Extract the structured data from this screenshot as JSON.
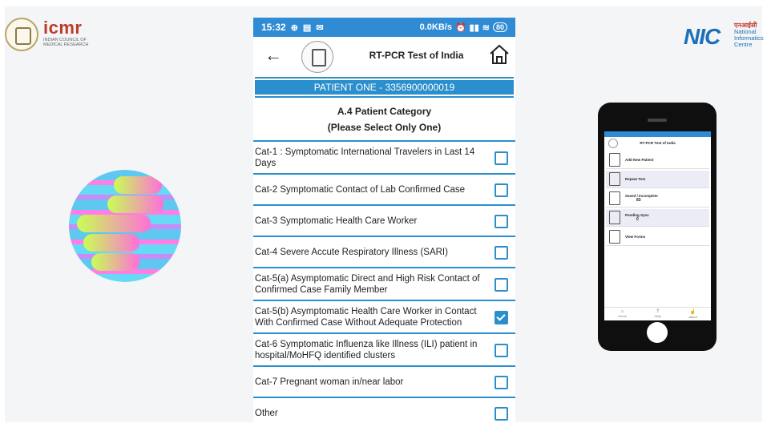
{
  "logos": {
    "icmr_word": "icmr",
    "icmr_sub": "INDIAN COUNCIL OF MEDICAL RESEARCH",
    "nic_word": "NIC",
    "nic_hindi": "एनआईसी",
    "nic_name_1": "National",
    "nic_name_2": "Informatics",
    "nic_name_3": "Centre"
  },
  "status_bar": {
    "time": "15:32",
    "speed": "0.0KB/s",
    "battery": "80",
    "icons": [
      "whatsapp-icon",
      "message-icon",
      "mail-icon"
    ]
  },
  "app": {
    "title": "RT-PCR Test of India",
    "back_icon": "arrow-left-icon",
    "home_icon": "home-icon"
  },
  "patient_banner": "PATIENT ONE - 3356900000019",
  "section": {
    "title": "A.4 Patient Category",
    "subtitle": "(Please Select Only One)"
  },
  "categories": [
    {
      "label": "Cat-1 : Symptomatic International Travelers in Last 14 Days",
      "checked": false
    },
    {
      "label": "Cat-2 Symptomatic Contact  of Lab Confirmed Case",
      "checked": false
    },
    {
      "label": "Cat-3 Symptomatic Health Care Worker",
      "checked": false
    },
    {
      "label": "Cat-4 Severe Accute Respiratory Illness (SARI)",
      "checked": false
    },
    {
      "label": "Cat-5(a) Asymptomatic Direct and High Risk Contact  of Confirmed Case Family Member",
      "checked": false
    },
    {
      "label": "Cat-5(b) Asymptomatic Health Care Worker in Contact With Confirmed Case Without Adequate Protection",
      "checked": true
    },
    {
      "label": "Cat-6 Symptomatic Influenza like Illness (ILI) patient in hospital/MoHFQ identified clusters",
      "checked": false
    },
    {
      "label": "Cat-7 Pregnant woman in/near labor",
      "checked": false
    },
    {
      "label": "Other",
      "checked": false
    }
  ],
  "mini_phone": {
    "title": "RT-PCR Test of India",
    "rows": [
      {
        "label": "Add New Patient",
        "count": ""
      },
      {
        "label": "Repeat Test",
        "count": ""
      },
      {
        "label": "Saved / Incomplete",
        "count": "83"
      },
      {
        "label": "Pending Sync",
        "count": "0"
      },
      {
        "label": "View Forms",
        "count": ""
      }
    ],
    "nav": [
      "Home",
      "Help",
      "About"
    ]
  }
}
